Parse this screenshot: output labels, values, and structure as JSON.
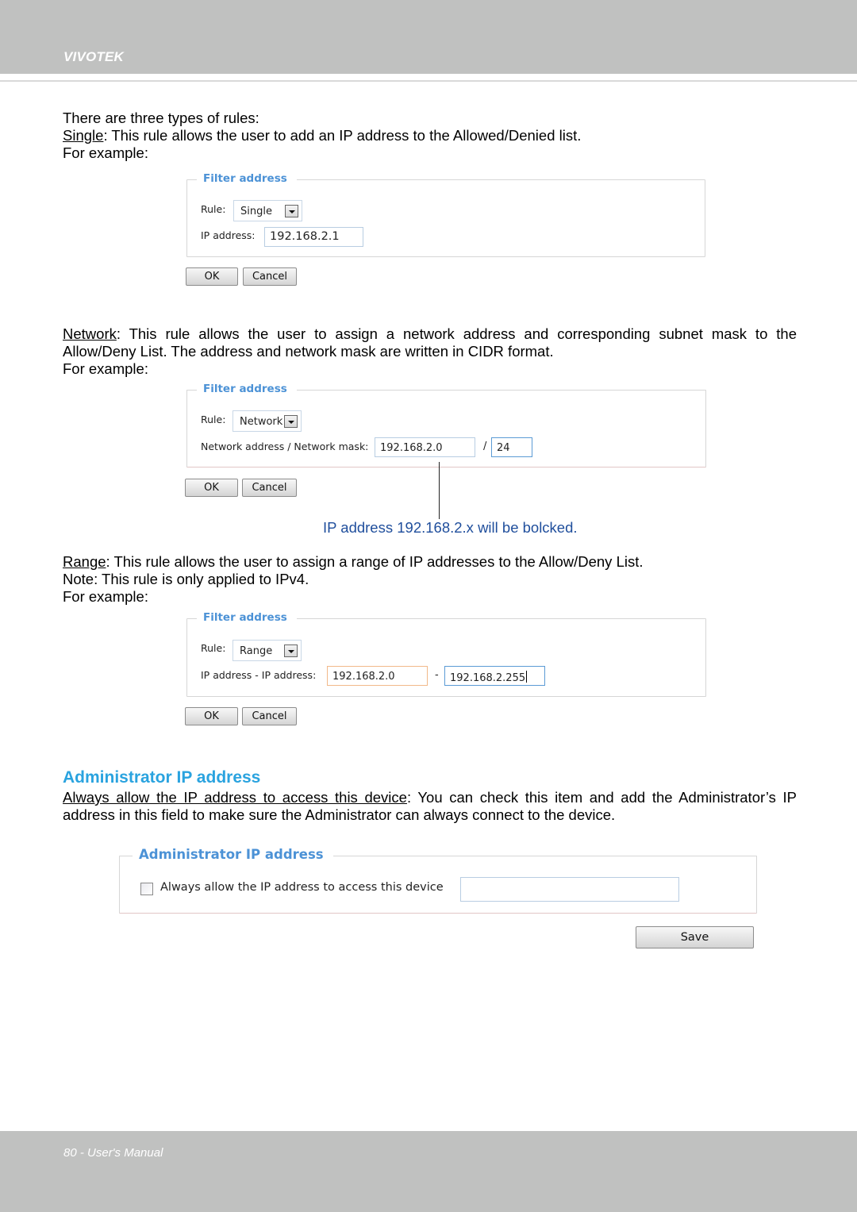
{
  "header": {
    "brand": "VIVOTEK"
  },
  "intro": {
    "line1": "There are three types of rules:",
    "single_term": "Single",
    "single_desc": ": This rule allows the user to add an IP address to the Allowed/Denied list.",
    "for_example": "For example:"
  },
  "single_example": {
    "legend": "Filter address",
    "rule_label": "Rule:",
    "rule_value": "Single",
    "ip_label": "IP address:",
    "ip_value": "192.168.2.1",
    "ok": "OK",
    "cancel": "Cancel"
  },
  "network_text": {
    "term": "Network",
    "desc": ": This rule allows the user to assign a network address and corresponding subnet mask to the Allow/Deny List. The address and network mask are written in CIDR format.",
    "for_example": "For example:"
  },
  "network_example": {
    "legend": "Filter address",
    "rule_label": "Rule:",
    "rule_value": "Network",
    "addr_label": "Network address / Network mask:",
    "addr_value": "192.168.2.0",
    "slash": "/",
    "mask_value": "24",
    "ok": "OK",
    "cancel": "Cancel",
    "callout": "IP address 192.168.2.x will be bolcked."
  },
  "range_text": {
    "term": "Range",
    "desc": ": This rule allows the user to assign a range of IP addresses to the Allow/Deny List.",
    "note": "Note: This rule is only applied to IPv4.",
    "for_example": "For example:"
  },
  "range_example": {
    "legend": "Filter address",
    "rule_label": "Rule:",
    "rule_value": "Range",
    "addr_label": "IP address - IP address:",
    "start_value": "192.168.2.0",
    "dash": "-",
    "end_value": "192.168.2.255",
    "ok": "OK",
    "cancel": "Cancel"
  },
  "admin_section": {
    "title": "Administrator IP address",
    "term": "Always allow the IP address to access this device",
    "desc": ": You can check this item and add the Administrator’s IP address in this field to make sure the Administrator can always connect to the device."
  },
  "admin_example": {
    "legend": "Administrator IP address",
    "checkbox_label": "Always allow the IP address to access this device",
    "checked": false,
    "ip_value": "",
    "save": "Save"
  },
  "footer": {
    "text": "80 - User's Manual"
  }
}
